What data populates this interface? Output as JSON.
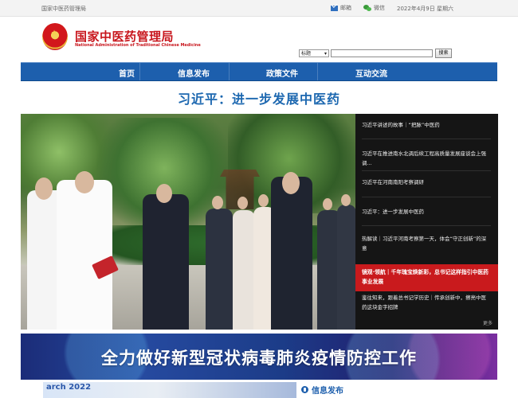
{
  "topbar": {
    "site_name": "国家中医药管理局",
    "mail_label": "邮箱",
    "wechat_label": "微信",
    "date": "2022年4月9日 星期六"
  },
  "header": {
    "logo_cn": "国家中医药管理局",
    "logo_en": "National Administration of Traditional Chinese Medicine"
  },
  "search": {
    "select_value": "标题",
    "input_value": "",
    "button_label": "搜索"
  },
  "nav": {
    "items": [
      {
        "label": "首页"
      },
      {
        "label": "信息发布"
      },
      {
        "label": "政策文件"
      },
      {
        "label": "互动交流"
      }
    ]
  },
  "headline": "习近平：进一步发展中医药",
  "captions": [
    "习近平讲述的故事｜“把脉”中医药",
    "习近平在推进南水北调后续工程高质量发展座谈会上强调...",
    "习近平在河南南阳考察调研",
    "习近平：进一步发展中医药",
    "热解读｜习近平河南考察第一天，体会“守正创新”的深意",
    "镜观·领航｜千年瑰宝焕新彩，总书记这样指引中医药事业发展",
    "鉴往知来，跟着总书记学历史｜传承创新中，擦亮中医药这块金字招牌"
  ],
  "more_label": "更多",
  "banner": {
    "text": "全力做好新型冠状病毒肺炎疫情防控工作"
  },
  "bottom": {
    "thumbnail_text": "arch 2022",
    "info_title": "信息发布"
  },
  "colors": {
    "primary_blue": "#1d5fad",
    "headline_blue": "#1d68b0",
    "accent_red": "#c91a1d"
  }
}
